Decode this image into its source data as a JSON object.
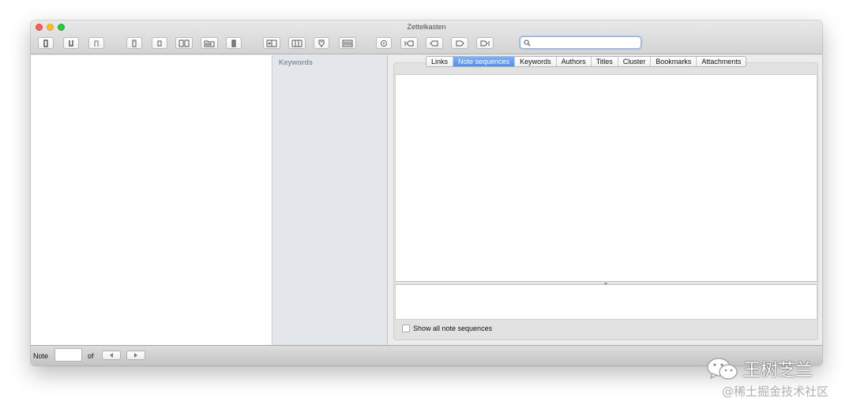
{
  "window": {
    "title": "Zettelkasten"
  },
  "toolbar": {
    "icons": [
      "new-note-icon",
      "underline-icon",
      "cap-icon",
      "doc-icon",
      "doc-small-icon",
      "two-cards-icon",
      "folder-icon",
      "stack-icon",
      "split-left-icon",
      "split-cols-icon",
      "tag-down-icon",
      "barcode-icon",
      "circle-icon",
      "first-note-icon",
      "prev-note-icon",
      "next-note-icon",
      "last-note-icon"
    ]
  },
  "search": {
    "value": "",
    "placeholder": ""
  },
  "keywords_panel": {
    "header": "Keywords"
  },
  "tabs": [
    {
      "label": "Links",
      "active": false
    },
    {
      "label": "Note sequences",
      "active": true
    },
    {
      "label": "Keywords",
      "active": false
    },
    {
      "label": "Authors",
      "active": false
    },
    {
      "label": "Titles",
      "active": false
    },
    {
      "label": "Cluster",
      "active": false
    },
    {
      "label": "Bookmarks",
      "active": false
    },
    {
      "label": "Attachments",
      "active": false
    }
  ],
  "sequence_panel": {
    "checkbox_label": "Show all note sequences",
    "checked": false
  },
  "status": {
    "note_label": "Note",
    "note_value": "",
    "of_label": "of"
  },
  "watermark": {
    "title": "玉树芝兰",
    "subtitle": "@稀土掘金技术社区"
  },
  "colors": {
    "accent": "#5a98f2",
    "close": "#fc5f57",
    "minimize": "#fdbc2e",
    "maximize": "#28c840"
  }
}
